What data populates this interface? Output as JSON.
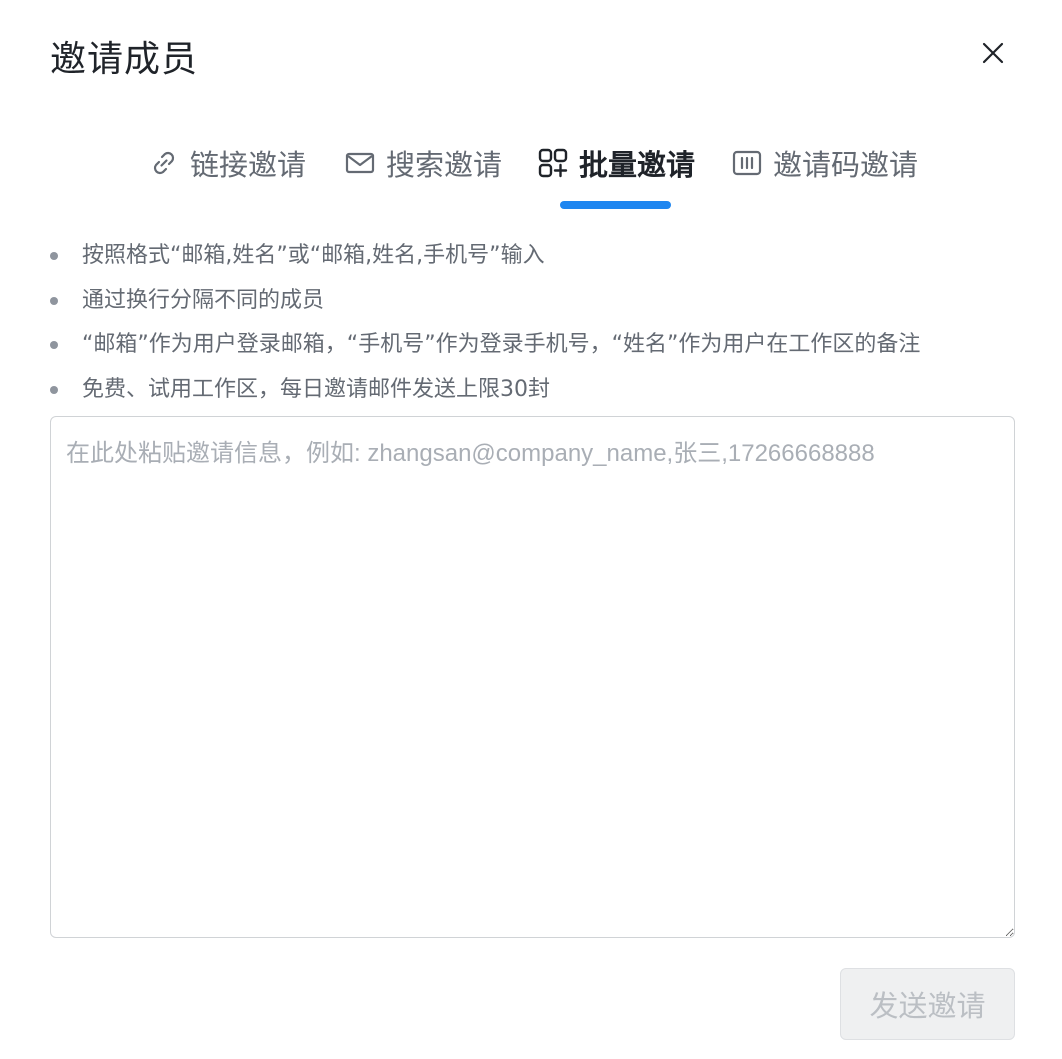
{
  "dialog": {
    "title": "邀请成员",
    "close_icon": "close-icon"
  },
  "tabs": [
    {
      "label": "链接邀请",
      "icon": "link-icon",
      "active": false
    },
    {
      "label": "搜索邀请",
      "icon": "mail-icon",
      "active": false
    },
    {
      "label": "批量邀请",
      "icon": "bulk-add-icon",
      "active": true
    },
    {
      "label": "邀请码邀请",
      "icon": "code-icon",
      "active": false
    }
  ],
  "rules": [
    "按照格式“邮箱,姓名”或“邮箱,姓名,手机号”输入",
    "通过换行分隔不同的成员",
    "“邮箱”作为用户登录邮箱，“手机号”作为登录手机号，“姓名”作为用户在工作区的备注",
    "免费、试用工作区，每日邀请邮件发送上限30封"
  ],
  "input": {
    "placeholder": "在此处粘贴邀请信息，例如: zhangsan@company_name,张三,17266668888",
    "value": ""
  },
  "footer": {
    "send_label": "发送邀请"
  },
  "colors": {
    "accent": "#1e86f0",
    "text_primary": "#1f2329",
    "text_secondary": "#646a73",
    "disabled_bg": "#eff0f1",
    "disabled_text": "#bbbfc4"
  }
}
